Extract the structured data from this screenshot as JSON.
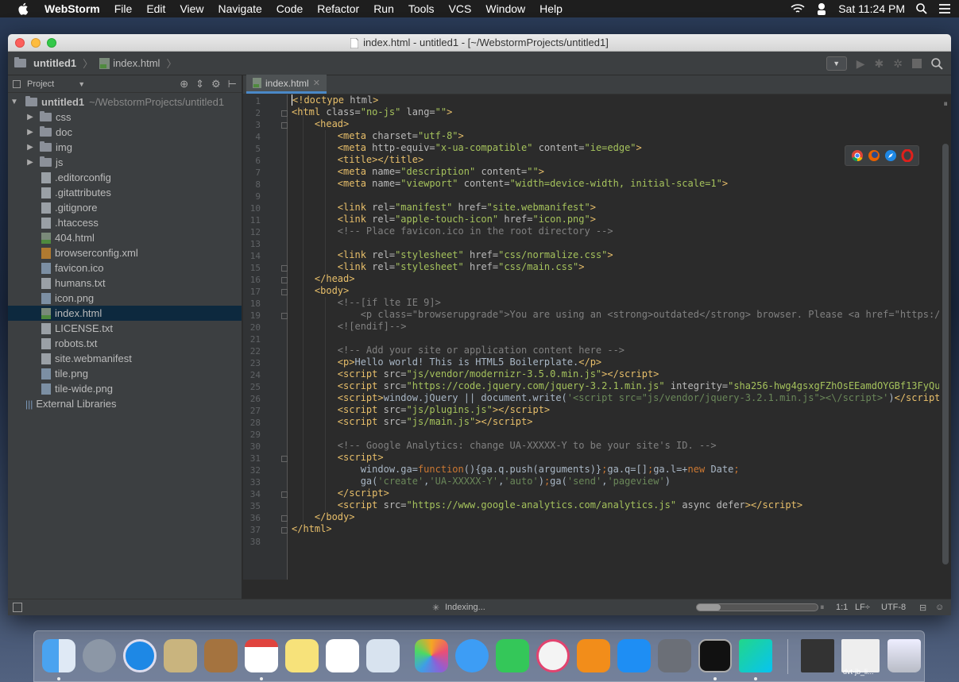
{
  "menubar": {
    "app": "WebStorm",
    "items": [
      "File",
      "Edit",
      "View",
      "Navigate",
      "Code",
      "Refactor",
      "Run",
      "Tools",
      "VCS",
      "Window",
      "Help"
    ],
    "clock": "Sat 11:24 PM"
  },
  "window": {
    "title": "index.html - untitled1 - [~/WebstormProjects/untitled1]"
  },
  "navbar": {
    "project": "untitled1",
    "file": "index.html"
  },
  "project_pane": {
    "header": "Project",
    "root": {
      "name": "untitled1",
      "path": "~/WebstormProjects/untitled1"
    },
    "folders": [
      "css",
      "doc",
      "img",
      "js"
    ],
    "files": [
      ".editorconfig",
      ".gitattributes",
      ".gitignore",
      ".htaccess",
      "404.html",
      "browserconfig.xml",
      "favicon.ico",
      "humans.txt",
      "icon.png",
      "index.html",
      "LICENSE.txt",
      "robots.txt",
      "site.webmanifest",
      "tile.png",
      "tile-wide.png"
    ],
    "external": "External Libraries"
  },
  "editor": {
    "tab": "index.html",
    "line_numbers": [
      "1",
      "2",
      "3",
      "4",
      "5",
      "6",
      "7",
      "8",
      "9",
      "10",
      "11",
      "12",
      "13",
      "14",
      "15",
      "16",
      "17",
      "18",
      "19",
      "20",
      "21",
      "22",
      "23",
      "24",
      "25",
      "26",
      "27",
      "28",
      "29",
      "30",
      "31",
      "32",
      "33",
      "34",
      "35",
      "36",
      "37",
      "38"
    ]
  },
  "status": {
    "indexing": "Indexing...",
    "position": "1:1",
    "line_sep": "LF÷",
    "encoding": "UTF-8"
  },
  "dock": {
    "label": "dvt-jb_li..."
  },
  "colors": {
    "accent": "#4a88c7",
    "selection": "#0d293e",
    "editor_bg": "#2b2b2b",
    "panel_bg": "#3c3f41"
  },
  "icons": [
    "apple-icon",
    "wifi-icon",
    "user-icon",
    "search-icon",
    "list-icon",
    "html-file-icon",
    "chrome-icon",
    "firefox-icon",
    "safari-icon",
    "opera-icon"
  ]
}
